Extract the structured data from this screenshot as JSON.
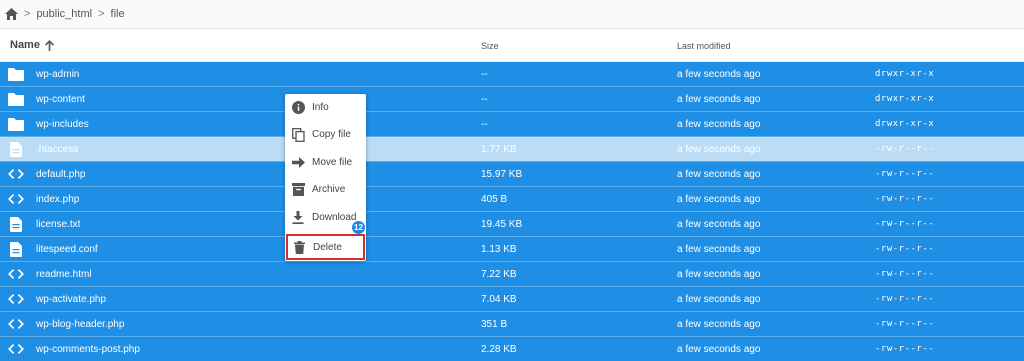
{
  "breadcrumb": {
    "items": [
      "public_html",
      "file"
    ]
  },
  "header": {
    "name": "Name",
    "size": "Size",
    "modified": "Last modified"
  },
  "files": [
    {
      "name": "wp-admin",
      "size": "--",
      "modified": "a few seconds ago",
      "perm": "drwxr-xr-x",
      "icon": "folder-icon"
    },
    {
      "name": "wp-content",
      "size": "--",
      "modified": "a few seconds ago",
      "perm": "drwxr-xr-x",
      "icon": "folder-icon"
    },
    {
      "name": "wp-includes",
      "size": "--",
      "modified": "a few seconds ago",
      "perm": "drwxr-xr-x",
      "icon": "folder-icon"
    },
    {
      "name": ".htaccess",
      "size": "1.77 KB",
      "modified": "a few seconds ago",
      "perm": "-rw-r--r--",
      "icon": "document-icon"
    },
    {
      "name": "default.php",
      "size": "15.97 KB",
      "modified": "a few seconds ago",
      "perm": "-rw-r--r--",
      "icon": "code-icon"
    },
    {
      "name": "index.php",
      "size": "405 B",
      "modified": "a few seconds ago",
      "perm": "-rw-r--r--",
      "icon": "code-icon"
    },
    {
      "name": "license.txt",
      "size": "19.45 KB",
      "modified": "a few seconds ago",
      "perm": "-rw-r--r--",
      "icon": "document-icon"
    },
    {
      "name": "litespeed.conf",
      "size": "1.13 KB",
      "modified": "a few seconds ago",
      "perm": "-rw-r--r--",
      "icon": "document-icon"
    },
    {
      "name": "readme.html",
      "size": "7.22 KB",
      "modified": "a few seconds ago",
      "perm": "-rw-r--r--",
      "icon": "code-icon"
    },
    {
      "name": "wp-activate.php",
      "size": "7.04 KB",
      "modified": "a few seconds ago",
      "perm": "-rw-r--r--",
      "icon": "code-icon"
    },
    {
      "name": "wp-blog-header.php",
      "size": "351 B",
      "modified": "a few seconds ago",
      "perm": "-rw-r--r--",
      "icon": "code-icon"
    },
    {
      "name": "wp-comments-post.php",
      "size": "2.28 KB",
      "modified": "a few seconds ago",
      "perm": "-rw-r--r--",
      "icon": "code-icon"
    }
  ],
  "context_menu": {
    "items": [
      {
        "label": "Info",
        "icon": "info-icon"
      },
      {
        "label": "Copy file",
        "icon": "copy-icon"
      },
      {
        "label": "Move file",
        "icon": "arrow-right-icon"
      },
      {
        "label": "Archive",
        "icon": "archive-icon"
      },
      {
        "label": "Download",
        "icon": "download-icon"
      },
      {
        "label": "Delete",
        "icon": "trash-icon"
      }
    ],
    "badge": "12"
  },
  "colors": {
    "selected_row": "#1f8fe6",
    "highlight_row": "#bcdcf6",
    "delete_outline": "#d32f2f",
    "badge": "#1e88e5"
  }
}
